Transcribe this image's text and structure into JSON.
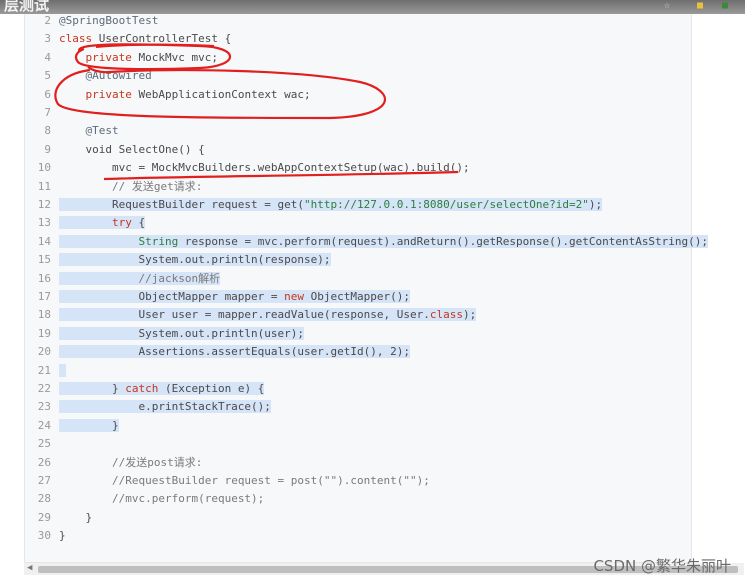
{
  "window": {
    "title": "层测试"
  },
  "code": {
    "lines": [
      {
        "num": "2",
        "parts": [
          {
            "c": "an",
            "t": "@SpringBootTest"
          }
        ]
      },
      {
        "num": "3",
        "parts": [
          {
            "c": "kw",
            "t": "class "
          },
          {
            "c": "ty",
            "t": "UserControllerTest {"
          }
        ]
      },
      {
        "num": "4",
        "parts": [
          {
            "c": "ty",
            "t": "    "
          },
          {
            "c": "kw",
            "t": "private "
          },
          {
            "c": "ty",
            "t": "MockMvc mvc;"
          }
        ]
      },
      {
        "num": "5",
        "parts": [
          {
            "c": "ty",
            "t": "    "
          },
          {
            "c": "an",
            "t": "@Autowired"
          }
        ]
      },
      {
        "num": "6",
        "parts": [
          {
            "c": "ty",
            "t": "    "
          },
          {
            "c": "kw",
            "t": "private "
          },
          {
            "c": "ty",
            "t": "WebApplicationContext wac;"
          }
        ]
      },
      {
        "num": "7",
        "parts": [
          {
            "c": "ty",
            "t": ""
          }
        ]
      },
      {
        "num": "8",
        "parts": [
          {
            "c": "ty",
            "t": "    "
          },
          {
            "c": "an",
            "t": "@Test"
          }
        ]
      },
      {
        "num": "9",
        "parts": [
          {
            "c": "ty",
            "t": "    void SelectOne() {"
          }
        ]
      },
      {
        "num": "10",
        "parts": [
          {
            "c": "ty",
            "t": "        mvc = MockMvcBuilders.webAppContextSetup(wac).build();"
          }
        ]
      },
      {
        "num": "11",
        "parts": [
          {
            "c": "ty",
            "t": "        "
          },
          {
            "c": "cm",
            "t": "// 发送get请求:"
          }
        ]
      },
      {
        "num": "12",
        "sel": true,
        "parts": [
          {
            "c": "ty",
            "t": "        RequestBuilder request = get("
          },
          {
            "c": "str",
            "t": "\"http://127.0.0.1:8080/user/selectOne?id=2\""
          },
          {
            "c": "ty",
            "t": ");"
          }
        ]
      },
      {
        "num": "13",
        "sel": true,
        "parts": [
          {
            "c": "ty",
            "t": "        "
          },
          {
            "c": "kw",
            "t": "try"
          },
          {
            "c": "ty",
            "t": " {"
          }
        ]
      },
      {
        "num": "14",
        "sel": true,
        "parts": [
          {
            "c": "ty",
            "t": "            "
          },
          {
            "c": "str",
            "t": "String"
          },
          {
            "c": "ty",
            "t": " response = mvc.perform(request).andReturn().getResponse().getContentAsString();"
          }
        ]
      },
      {
        "num": "15",
        "sel": true,
        "parts": [
          {
            "c": "ty",
            "t": "            System.out.println(response);"
          }
        ]
      },
      {
        "num": "16",
        "sel": true,
        "parts": [
          {
            "c": "ty",
            "t": "            "
          },
          {
            "c": "cm",
            "t": "//jackson解析"
          }
        ]
      },
      {
        "num": "17",
        "sel": true,
        "parts": [
          {
            "c": "ty",
            "t": "            ObjectMapper mapper = "
          },
          {
            "c": "kw",
            "t": "new"
          },
          {
            "c": "ty",
            "t": " ObjectMapper();"
          }
        ]
      },
      {
        "num": "18",
        "sel": true,
        "parts": [
          {
            "c": "ty",
            "t": "            User user = mapper.readValue(response, User."
          },
          {
            "c": "kw",
            "t": "class"
          },
          {
            "c": "ty",
            "t": ");"
          }
        ]
      },
      {
        "num": "19",
        "sel": true,
        "parts": [
          {
            "c": "ty",
            "t": "            System.out.println(user);"
          }
        ]
      },
      {
        "num": "20",
        "sel": true,
        "parts": [
          {
            "c": "ty",
            "t": "            Assertions.assertEquals(user.getId(), 2);"
          }
        ]
      },
      {
        "num": "21",
        "sel": true,
        "parts": [
          {
            "c": "ty",
            "t": " "
          }
        ]
      },
      {
        "num": "22",
        "sel": true,
        "parts": [
          {
            "c": "ty",
            "t": "        } "
          },
          {
            "c": "kw",
            "t": "catch"
          },
          {
            "c": "ty",
            "t": " (Exception e) {"
          }
        ]
      },
      {
        "num": "23",
        "sel": true,
        "parts": [
          {
            "c": "ty",
            "t": "            e.printStackTrace();"
          }
        ]
      },
      {
        "num": "24",
        "sel": true,
        "parts": [
          {
            "c": "ty",
            "t": "        }"
          }
        ]
      },
      {
        "num": "25",
        "parts": [
          {
            "c": "ty",
            "t": ""
          }
        ]
      },
      {
        "num": "26",
        "parts": [
          {
            "c": "ty",
            "t": "        "
          },
          {
            "c": "cm",
            "t": "//发送post请求:"
          }
        ]
      },
      {
        "num": "27",
        "parts": [
          {
            "c": "ty",
            "t": "        "
          },
          {
            "c": "cm",
            "t": "//RequestBuilder request = post(\"\").content(\"\");"
          }
        ]
      },
      {
        "num": "28",
        "parts": [
          {
            "c": "ty",
            "t": "        "
          },
          {
            "c": "cm",
            "t": "//mvc.perform(request);"
          }
        ]
      },
      {
        "num": "29",
        "parts": [
          {
            "c": "ty",
            "t": "    }"
          }
        ]
      },
      {
        "num": "30",
        "parts": [
          {
            "c": "ty",
            "t": "}"
          }
        ]
      }
    ]
  },
  "icons": {
    "star": "star-icon",
    "extension": "extension-icon"
  },
  "colors": {
    "annotation_red": "#e0201e",
    "selection": "#d6e4f8",
    "keyword": "#c4361d",
    "string": "#2e7d3d"
  },
  "watermark": "CSDN @繁华朱丽叶"
}
